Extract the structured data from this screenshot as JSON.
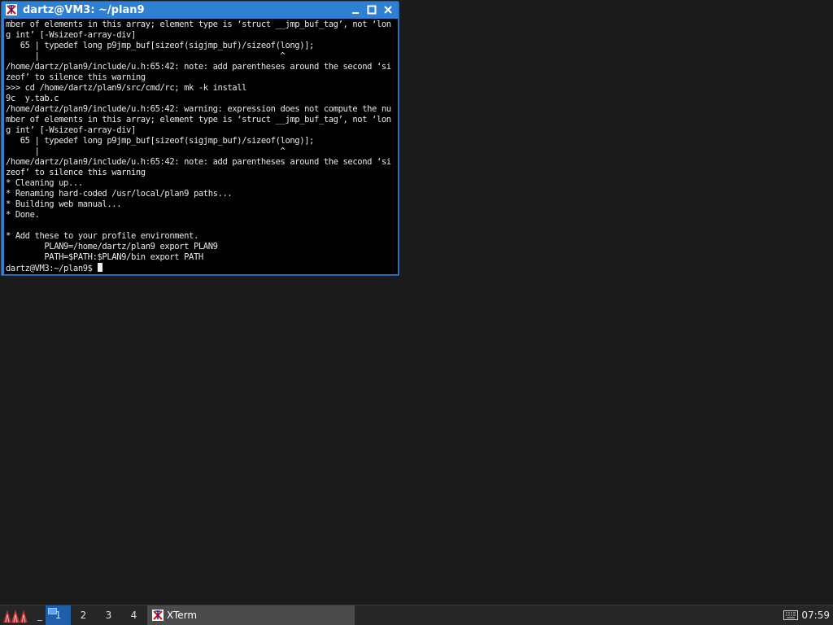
{
  "window": {
    "title": "dartz@VM3: ~/plan9",
    "buttons": [
      "minimize",
      "maximize",
      "close"
    ]
  },
  "terminal": {
    "lines": [
      "mber of elements in this array; element type is ‘struct __jmp_buf_tag’, not ‘lon",
      "g int’ [-Wsizeof-array-div]",
      "   65 | typedef long p9jmp_buf[sizeof(sigjmp_buf)/sizeof(long)];",
      "      |                                                  ^",
      "/home/dartz/plan9/include/u.h:65:42: note: add parentheses around the second ‘si",
      "zeof’ to silence this warning",
      ">>> cd /home/dartz/plan9/src/cmd/rc; mk -k install",
      "9c  y.tab.c",
      "/home/dartz/plan9/include/u.h:65:42: warning: expression does not compute the nu",
      "mber of elements in this array; element type is ‘struct __jmp_buf_tag’, not ‘lon",
      "g int’ [-Wsizeof-array-div]",
      "   65 | typedef long p9jmp_buf[sizeof(sigjmp_buf)/sizeof(long)];",
      "      |                                                  ^",
      "/home/dartz/plan9/include/u.h:65:42: note: add parentheses around the second ‘si",
      "zeof’ to silence this warning",
      "* Cleaning up...",
      "* Renaming hard-coded /usr/local/plan9 paths...",
      "* Building web manual...",
      "* Done.",
      "",
      "* Add these to your profile environment.",
      "        PLAN9=/home/dartz/plan9 export PLAN9",
      "        PATH=$PATH:$PLAN9/bin export PATH"
    ],
    "prompt": "dartz@VM3:~/plan9$ "
  },
  "taskbar": {
    "workspaces": [
      "1",
      "2",
      "3",
      "4"
    ],
    "active_workspace": "1",
    "task_label": "XTerm",
    "clock": "07:59"
  },
  "icons": {
    "start": "menu-icon",
    "app": "xterm-icon",
    "keyboard": "keyboard-icon"
  },
  "colors": {
    "titlebar": "#2f7fd2",
    "active_workspace": "#1f5faa",
    "desktop": "#1b1b1b"
  }
}
